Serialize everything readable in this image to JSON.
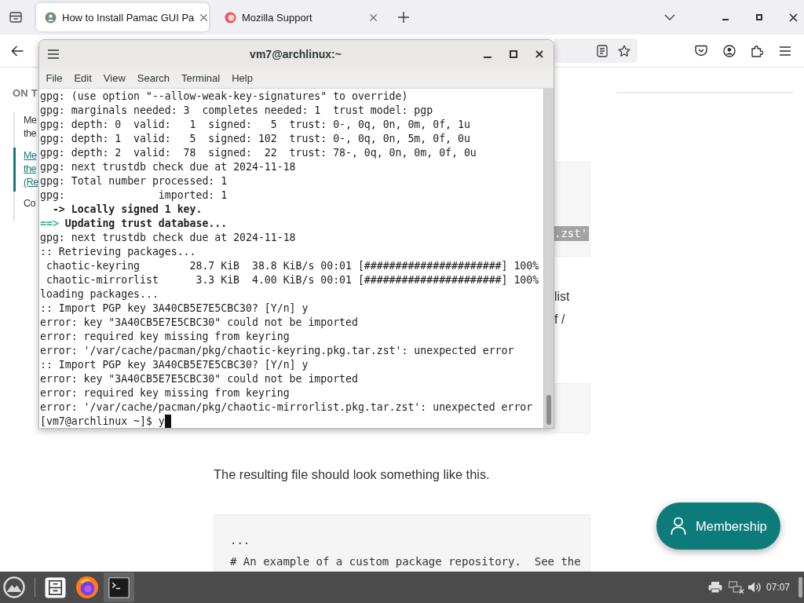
{
  "browser": {
    "tabs": [
      {
        "title": "How to Install Pamac GUI Pa",
        "selected": true
      },
      {
        "title": "Mozilla Support",
        "selected": false
      }
    ]
  },
  "page": {
    "toc": {
      "heading": "ON T",
      "items": [
        {
          "text": "Me the",
          "selected": false
        },
        {
          "text": "Me the (Re",
          "selected": true
        },
        {
          "text": "Co",
          "selected": false
        }
      ]
    },
    "fragments": [
      {
        "kind": "code_block",
        "selected_text": ".zst'"
      },
      {
        "kind": "text",
        "text": "list"
      },
      {
        "kind": "text",
        "text": "f /"
      },
      {
        "kind": "code_block"
      }
    ],
    "paragraph": "The resulting file should look something like this.",
    "code_block": {
      "lines": [
        "...",
        "# An example of a custom package repository.  See the"
      ]
    },
    "membership_button": {
      "label": "Membership"
    }
  },
  "terminal": {
    "title": "vm7@archlinux:~",
    "menu": [
      "File",
      "Edit",
      "View",
      "Search",
      "Terminal",
      "Help"
    ],
    "lines": [
      {
        "kind": "plain",
        "text": "gpg: (use option \"--allow-weak-key-signatures\" to override)"
      },
      {
        "kind": "plain",
        "text": "gpg: marginals needed: 3  completes needed: 1  trust model: pgp"
      },
      {
        "kind": "plain",
        "text": "gpg: depth: 0  valid:   1  signed:   5  trust: 0-, 0q, 0n, 0m, 0f, 1u"
      },
      {
        "kind": "plain",
        "text": "gpg: depth: 1  valid:   5  signed: 102  trust: 0-, 0q, 0n, 5m, 0f, 0u"
      },
      {
        "kind": "plain",
        "text": "gpg: depth: 2  valid:  78  signed:  22  trust: 78-, 0q, 0n, 0m, 0f, 0u"
      },
      {
        "kind": "plain",
        "text": "gpg: next trustdb check due at 2024-11-18"
      },
      {
        "kind": "plain",
        "text": "gpg: Total number processed: 1"
      },
      {
        "kind": "plain",
        "text": "gpg:               imported: 1"
      },
      {
        "kind": "substep",
        "marker": "->",
        "text": "Locally signed 1 key."
      },
      {
        "kind": "stage",
        "marker": "==>",
        "text": "Updating trust database..."
      },
      {
        "kind": "plain",
        "text": "gpg: next trustdb check due at 2024-11-18"
      },
      {
        "kind": "plain",
        "text": ":: Retrieving packages..."
      },
      {
        "kind": "progress",
        "text": "chaotic-keyring        28.7 KiB  38.8 KiB/s 00:01 [######################] 100%"
      },
      {
        "kind": "progress",
        "text": "chaotic-mirrorlist      3.3 KiB  4.00 KiB/s 00:01 [######################] 100%"
      },
      {
        "kind": "plain",
        "text": "loading packages..."
      },
      {
        "kind": "plain",
        "text": ":: Import PGP key 3A40CB5E7E5CBC30? [Y/n] y"
      },
      {
        "kind": "plain",
        "text": "error: key \"3A40CB5E7E5CBC30\" could not be imported"
      },
      {
        "kind": "plain",
        "text": "error: required key missing from keyring"
      },
      {
        "kind": "plain",
        "text": "error: '/var/cache/pacman/pkg/chaotic-keyring.pkg.tar.zst': unexpected error"
      },
      {
        "kind": "plain",
        "text": ":: Import PGP key 3A40CB5E7E5CBC30? [Y/n] y"
      },
      {
        "kind": "plain",
        "text": "error: key \"3A40CB5E7E5CBC30\" could not be imported"
      },
      {
        "kind": "plain",
        "text": "error: required key missing from keyring"
      },
      {
        "kind": "plain",
        "text": "error: '/var/cache/pacman/pkg/chaotic-mirrorlist.pkg.tar.zst': unexpected error"
      },
      {
        "kind": "prompt",
        "text": "[vm7@archlinux ~]$ y"
      }
    ]
  },
  "taskbar": {
    "launchers": [
      {
        "kind": "files",
        "active": false
      },
      {
        "kind": "browser",
        "active": false
      },
      {
        "kind": "terminal",
        "active": true
      }
    ],
    "clock": "07:07"
  }
}
